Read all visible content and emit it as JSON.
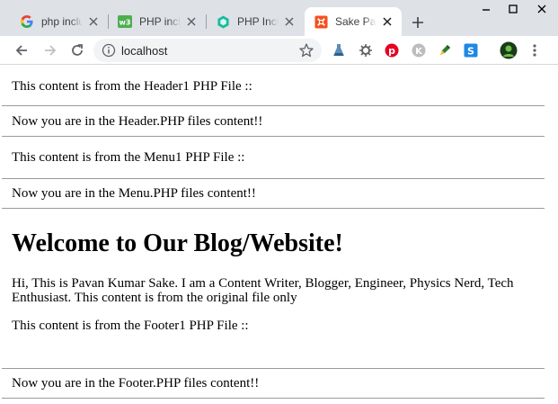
{
  "browser": {
    "tabs": [
      {
        "title": "php include",
        "favicon": "google-favicon",
        "active": false
      },
      {
        "title": "PHP include",
        "favicon": "w3schools-favicon",
        "active": false
      },
      {
        "title": "PHP Include",
        "favicon": "hexagon-favicon",
        "active": false
      },
      {
        "title": "Sake Pavan",
        "favicon": "sake-favicon",
        "active": true
      }
    ],
    "url": "localhost",
    "extensions": [
      "flask-icon",
      "gear-spark-icon",
      "pinterest-icon",
      "k-icon",
      "pen-icon",
      "s-icon"
    ],
    "colors": {
      "tabstrip": "#dee1e6",
      "omnibox": "#f1f3f4",
      "accent_orange": "#f4511e",
      "pinterest": "#e60023"
    }
  },
  "page": {
    "header1": "This content is from the Header1 PHP File ::",
    "header_msg": "Now you are in the Header.PHP files content!!",
    "menu1": "This content is from the Menu1 PHP File ::",
    "menu_msg": "Now you are in the Menu.PHP files content!!",
    "heading": "Welcome to Our Blog/Website!",
    "paragraph": "Hi, This is Pavan Kumar Sake. I am a Content Writer, Blogger, Engineer, Physics Nerd, Tech Enthusiast. This content is from the original file only",
    "footer1": "This content is from the Footer1 PHP File ::",
    "footer_msg": "Now you are in the Footer.PHP files content!!"
  }
}
